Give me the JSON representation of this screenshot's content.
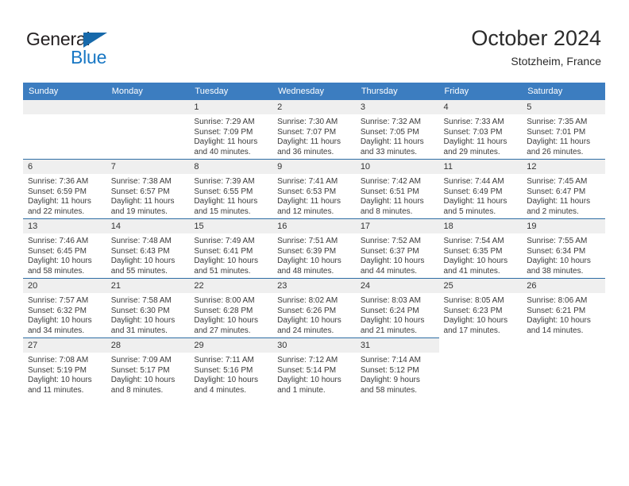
{
  "brand": {
    "name_top": "General",
    "name_bottom": "Blue",
    "accent_color": "#1877c4",
    "triangle_color": "#1769aa"
  },
  "header": {
    "title": "October 2024",
    "subtitle": "Stotzheim, France"
  },
  "theme": {
    "header_row_bg": "#3c7dc0",
    "day_strip_bg": "#efefef",
    "row_rule_color": "#2e6da4",
    "text_color": "#2b2b2b"
  },
  "weekday_headers": [
    "Sunday",
    "Monday",
    "Tuesday",
    "Wednesday",
    "Thursday",
    "Friday",
    "Saturday"
  ],
  "labels": {
    "sunrise_prefix": "Sunrise:",
    "sunset_prefix": "Sunset:",
    "daylight_prefix": "Daylight:"
  },
  "weeks": [
    [
      {
        "day": "",
        "empty": true
      },
      {
        "day": "",
        "empty": true
      },
      {
        "day": "1",
        "sunrise": "Sunrise: 7:29 AM",
        "sunset": "Sunset: 7:09 PM",
        "daylight": "Daylight: 11 hours and 40 minutes."
      },
      {
        "day": "2",
        "sunrise": "Sunrise: 7:30 AM",
        "sunset": "Sunset: 7:07 PM",
        "daylight": "Daylight: 11 hours and 36 minutes."
      },
      {
        "day": "3",
        "sunrise": "Sunrise: 7:32 AM",
        "sunset": "Sunset: 7:05 PM",
        "daylight": "Daylight: 11 hours and 33 minutes."
      },
      {
        "day": "4",
        "sunrise": "Sunrise: 7:33 AM",
        "sunset": "Sunset: 7:03 PM",
        "daylight": "Daylight: 11 hours and 29 minutes."
      },
      {
        "day": "5",
        "sunrise": "Sunrise: 7:35 AM",
        "sunset": "Sunset: 7:01 PM",
        "daylight": "Daylight: 11 hours and 26 minutes."
      }
    ],
    [
      {
        "day": "6",
        "sunrise": "Sunrise: 7:36 AM",
        "sunset": "Sunset: 6:59 PM",
        "daylight": "Daylight: 11 hours and 22 minutes."
      },
      {
        "day": "7",
        "sunrise": "Sunrise: 7:38 AM",
        "sunset": "Sunset: 6:57 PM",
        "daylight": "Daylight: 11 hours and 19 minutes."
      },
      {
        "day": "8",
        "sunrise": "Sunrise: 7:39 AM",
        "sunset": "Sunset: 6:55 PM",
        "daylight": "Daylight: 11 hours and 15 minutes."
      },
      {
        "day": "9",
        "sunrise": "Sunrise: 7:41 AM",
        "sunset": "Sunset: 6:53 PM",
        "daylight": "Daylight: 11 hours and 12 minutes."
      },
      {
        "day": "10",
        "sunrise": "Sunrise: 7:42 AM",
        "sunset": "Sunset: 6:51 PM",
        "daylight": "Daylight: 11 hours and 8 minutes."
      },
      {
        "day": "11",
        "sunrise": "Sunrise: 7:44 AM",
        "sunset": "Sunset: 6:49 PM",
        "daylight": "Daylight: 11 hours and 5 minutes."
      },
      {
        "day": "12",
        "sunrise": "Sunrise: 7:45 AM",
        "sunset": "Sunset: 6:47 PM",
        "daylight": "Daylight: 11 hours and 2 minutes."
      }
    ],
    [
      {
        "day": "13",
        "sunrise": "Sunrise: 7:46 AM",
        "sunset": "Sunset: 6:45 PM",
        "daylight": "Daylight: 10 hours and 58 minutes."
      },
      {
        "day": "14",
        "sunrise": "Sunrise: 7:48 AM",
        "sunset": "Sunset: 6:43 PM",
        "daylight": "Daylight: 10 hours and 55 minutes."
      },
      {
        "day": "15",
        "sunrise": "Sunrise: 7:49 AM",
        "sunset": "Sunset: 6:41 PM",
        "daylight": "Daylight: 10 hours and 51 minutes."
      },
      {
        "day": "16",
        "sunrise": "Sunrise: 7:51 AM",
        "sunset": "Sunset: 6:39 PM",
        "daylight": "Daylight: 10 hours and 48 minutes."
      },
      {
        "day": "17",
        "sunrise": "Sunrise: 7:52 AM",
        "sunset": "Sunset: 6:37 PM",
        "daylight": "Daylight: 10 hours and 44 minutes."
      },
      {
        "day": "18",
        "sunrise": "Sunrise: 7:54 AM",
        "sunset": "Sunset: 6:35 PM",
        "daylight": "Daylight: 10 hours and 41 minutes."
      },
      {
        "day": "19",
        "sunrise": "Sunrise: 7:55 AM",
        "sunset": "Sunset: 6:34 PM",
        "daylight": "Daylight: 10 hours and 38 minutes."
      }
    ],
    [
      {
        "day": "20",
        "sunrise": "Sunrise: 7:57 AM",
        "sunset": "Sunset: 6:32 PM",
        "daylight": "Daylight: 10 hours and 34 minutes."
      },
      {
        "day": "21",
        "sunrise": "Sunrise: 7:58 AM",
        "sunset": "Sunset: 6:30 PM",
        "daylight": "Daylight: 10 hours and 31 minutes."
      },
      {
        "day": "22",
        "sunrise": "Sunrise: 8:00 AM",
        "sunset": "Sunset: 6:28 PM",
        "daylight": "Daylight: 10 hours and 27 minutes."
      },
      {
        "day": "23",
        "sunrise": "Sunrise: 8:02 AM",
        "sunset": "Sunset: 6:26 PM",
        "daylight": "Daylight: 10 hours and 24 minutes."
      },
      {
        "day": "24",
        "sunrise": "Sunrise: 8:03 AM",
        "sunset": "Sunset: 6:24 PM",
        "daylight": "Daylight: 10 hours and 21 minutes."
      },
      {
        "day": "25",
        "sunrise": "Sunrise: 8:05 AM",
        "sunset": "Sunset: 6:23 PM",
        "daylight": "Daylight: 10 hours and 17 minutes."
      },
      {
        "day": "26",
        "sunrise": "Sunrise: 8:06 AM",
        "sunset": "Sunset: 6:21 PM",
        "daylight": "Daylight: 10 hours and 14 minutes."
      }
    ],
    [
      {
        "day": "27",
        "sunrise": "Sunrise: 7:08 AM",
        "sunset": "Sunset: 5:19 PM",
        "daylight": "Daylight: 10 hours and 11 minutes."
      },
      {
        "day": "28",
        "sunrise": "Sunrise: 7:09 AM",
        "sunset": "Sunset: 5:17 PM",
        "daylight": "Daylight: 10 hours and 8 minutes."
      },
      {
        "day": "29",
        "sunrise": "Sunrise: 7:11 AM",
        "sunset": "Sunset: 5:16 PM",
        "daylight": "Daylight: 10 hours and 4 minutes."
      },
      {
        "day": "30",
        "sunrise": "Sunrise: 7:12 AM",
        "sunset": "Sunset: 5:14 PM",
        "daylight": "Daylight: 10 hours and 1 minute."
      },
      {
        "day": "31",
        "sunrise": "Sunrise: 7:14 AM",
        "sunset": "Sunset: 5:12 PM",
        "daylight": "Daylight: 9 hours and 58 minutes."
      },
      {
        "day": "",
        "blank": true
      },
      {
        "day": "",
        "blank": true
      }
    ]
  ]
}
